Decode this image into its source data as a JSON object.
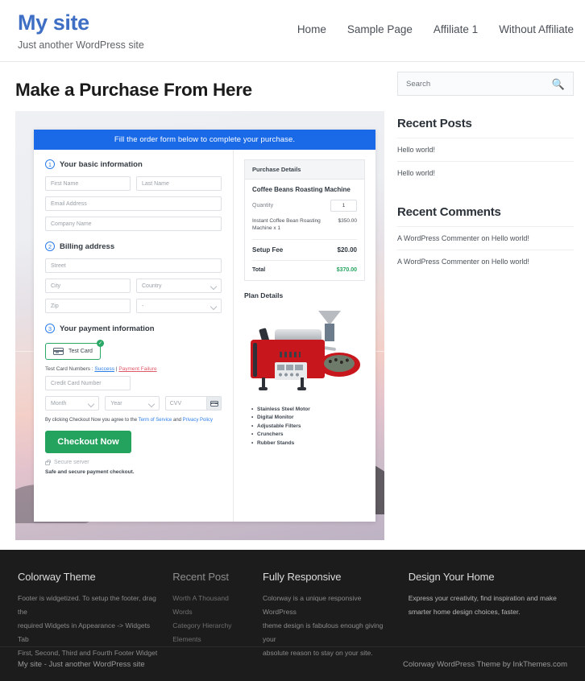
{
  "header": {
    "brand_title": "My site",
    "tagline": "Just another WordPress site",
    "nav": [
      {
        "label": "Home"
      },
      {
        "label": "Sample Page"
      },
      {
        "label": "Affiliate 1"
      },
      {
        "label": "Without Affiliate"
      }
    ]
  },
  "main": {
    "page_title": "Make a Purchase From Here",
    "banner": "Fill the order form below to complete your purchase.",
    "steps": {
      "step1_num": "1",
      "step1_label": "Your basic information",
      "step2_num": "2",
      "step2_label": "Billing address",
      "step3_num": "3",
      "step3_label": "Your payment information"
    },
    "fields": {
      "first_name": "First Name",
      "last_name": "Last Name",
      "email": "Email Address",
      "company": "Company Name",
      "street": "Street",
      "city": "City",
      "country": "Country",
      "zip": "Zip",
      "state": "-",
      "card_number": "Credit Card Number",
      "month": "Month",
      "year": "Year",
      "cvv": "CVV"
    },
    "payment": {
      "test_card_label": "Test  Card",
      "check_mark": "✓",
      "test_numbers_prefix": "Test Card Numbers : ",
      "success_link": "Success",
      "separator": " | ",
      "failure_link": "Payment Failure",
      "terms_prefix": "By clicking Checkout Now you agree to the ",
      "terms_link": "Term of Service",
      "terms_mid": " and ",
      "privacy_link": "Privacy Policy",
      "checkout_button": "Checkout Now",
      "secure_server": "Secure server",
      "safe_note": "Safe and secure payment checkout."
    },
    "summary": {
      "head": "Purchase Details",
      "product": "Coffee Beans Roasting Machine",
      "quantity_label": "Quantity",
      "quantity_value": "1",
      "line_item": "Instant Coffee Bean Roasting Machine x 1",
      "line_amount": "$350.00",
      "fee_label": "Setup Fee",
      "fee_amount": "$20.00",
      "total_label": "Total",
      "total_amount": "$370.00",
      "total_color": "#24a35e"
    },
    "plan": {
      "title": "Plan Details",
      "features": [
        "Stainless Steel Motor",
        "Digital Monitor",
        "Adjustable Filters",
        "Crunchers",
        "Rubber Stands"
      ]
    }
  },
  "sidebar": {
    "search_placeholder": "Search",
    "search_icon": "search-icon",
    "recent_posts_title": "Recent Posts",
    "recent_posts": [
      {
        "label": "Hello world!"
      },
      {
        "label": "Hello world!"
      }
    ],
    "recent_comments_title": "Recent Comments",
    "recent_comments": [
      {
        "label": "A WordPress Commenter on Hello world!"
      },
      {
        "label": "A WordPress Commenter on Hello world!"
      }
    ]
  },
  "footer": {
    "widgets": [
      {
        "title": "Colorway Theme",
        "lines": [
          "Footer is widgetized. To setup the footer, drag the",
          "required Widgets in Appearance -> Widgets Tab",
          "First, Second, Third and Fourth Footer Widget"
        ]
      },
      {
        "title": "Recent Post",
        "items": [
          "Worth A Thousand Words",
          "Category Hierarchy",
          "Elements"
        ]
      },
      {
        "title": "Fully Responsive",
        "lines": [
          "Colorway is a unique responsive WordPress",
          "theme design is fabulous enough giving your",
          "absolute reason to stay on your site."
        ]
      },
      {
        "title": "Design Your Home",
        "lines": [
          "Express your creativity, find inspiration and make",
          "smarter home design choices, faster."
        ]
      }
    ],
    "copyright_left": "My site - Just another WordPress site",
    "copyright_right": "Colorway WordPress Theme by InkThemes.com"
  }
}
